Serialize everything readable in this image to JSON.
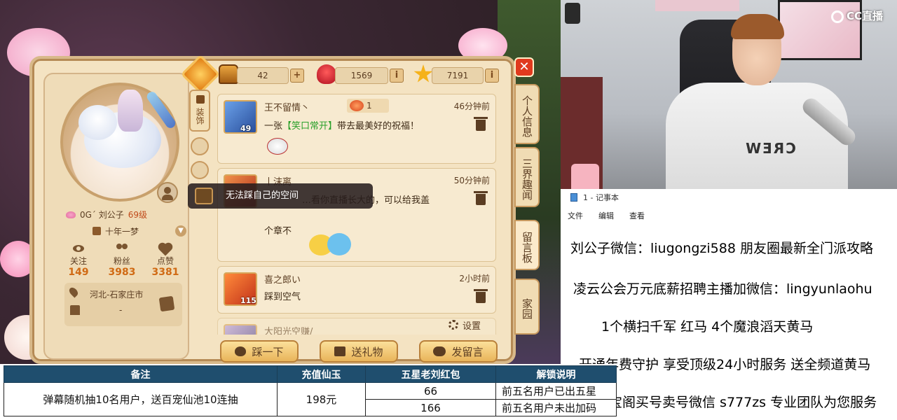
{
  "game": {
    "currency": {
      "gold": "42",
      "flowers": "1569",
      "stars": "7191"
    },
    "profile": {
      "name": "0G´ 刘公子",
      "level": "69级",
      "title": "十年一梦",
      "stats": [
        {
          "label": "关注",
          "value": "149",
          "icon": "eye-icon"
        },
        {
          "label": "粉丝",
          "value": "3983",
          "icon": "people-icon"
        },
        {
          "label": "点赞",
          "value": "3381",
          "icon": "heart-icon"
        }
      ],
      "location": "河北-石家庄市",
      "birthday": "-"
    },
    "side_tab_dress": "装饰",
    "messages": [
      {
        "name": "王不留情丶",
        "level": "49",
        "time": "46分钟前",
        "gift_count": "1",
        "text_prefix": "一张",
        "text_highlight": "【笑口常开】",
        "text_suffix": "带去最美好的祝福！"
      },
      {
        "name": "丨沫离",
        "level": "",
        "time": "50分钟前",
        "text_line1": "…看你直播长大的，可以给我盖",
        "text_line2": "个章不"
      },
      {
        "name": "喜之郎い",
        "level": "115",
        "time": "2小时前",
        "text": "踩到空气"
      },
      {
        "name": "大阳光空赚/"
      }
    ],
    "tooltip": "无法踩自己的空间",
    "settings": "设置",
    "buttons": {
      "step": "踩一下",
      "gift": "送礼物",
      "message": "发留言"
    },
    "right_tabs": [
      "个人信息",
      "三界趣闻",
      "留言板",
      "家园"
    ],
    "close": "✕"
  },
  "stream": {
    "logo": "CC直播",
    "shirt_text": "CREW"
  },
  "notepad": {
    "title": "1 - 记事本",
    "menu": [
      "文件",
      "编辑",
      "查看"
    ],
    "lines": [
      "刘公子微信：liugongzi588 朋友圈最新全门派攻略",
      "凌云公会万元底薪招聘主播加微信：lingyunlaohu",
      "1个横扫千军 红马    4个魔浪滔天黄马",
      "开通年费守护 享受顶级24小时服务 送全频道黄马",
      "藏宝阁买号卖号微信 s777zs 专业团队为您服务"
    ]
  },
  "reward_table": {
    "headers": [
      "备注",
      "充值仙玉",
      "五星老刘红包",
      "解锁说明"
    ],
    "note": "弹幕随机抽10名用户，送百宠仙池10连抽",
    "amount": "198元",
    "rows": [
      {
        "redpack": "66",
        "desc": "前五名用户已出五星"
      },
      {
        "redpack": "166",
        "desc": "前五名用户未出加码"
      }
    ]
  }
}
